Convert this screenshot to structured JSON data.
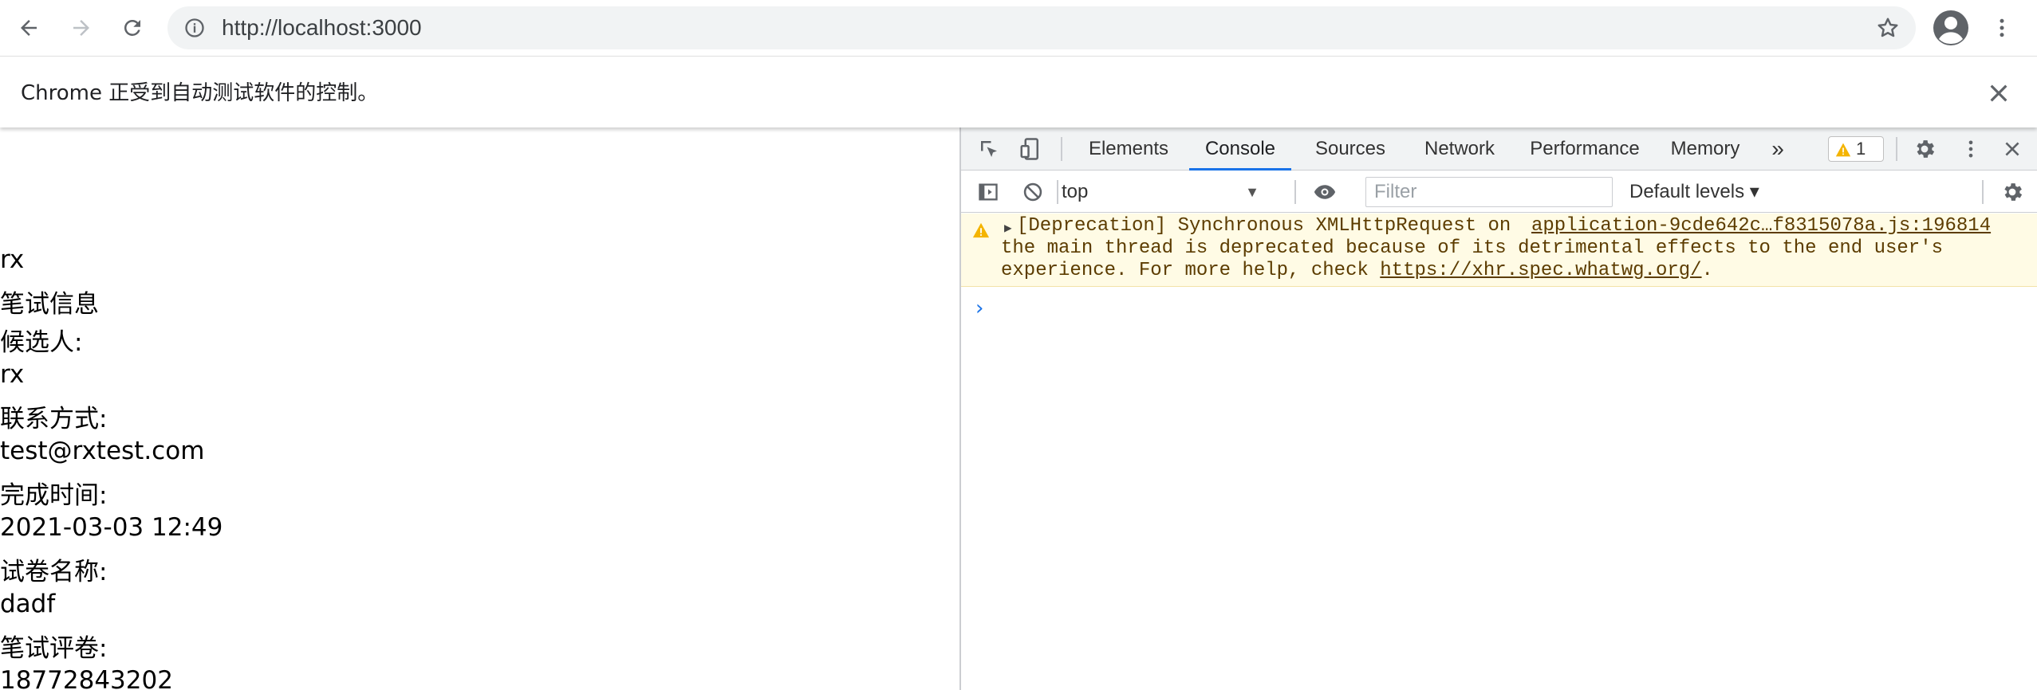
{
  "browser": {
    "url": "http://localhost:3000",
    "infobar_message": "Chrome 正受到自动测试软件的控制。"
  },
  "page": {
    "lines": [
      "rx",
      "笔试信息",
      "候选人:",
      "rx",
      "联系方式:",
      "test@rxtest.com",
      "完成时间:",
      "2021-03-03 12:49",
      "试卷名称:",
      "dadf",
      "笔试评卷:",
      "18772843202"
    ]
  },
  "devtools": {
    "tabs": [
      "Elements",
      "Console",
      "Sources",
      "Network",
      "Performance",
      "Memory"
    ],
    "active_tab": "Console",
    "more_tabs": "»",
    "warning_count": "1",
    "context": "top",
    "filter_placeholder": "Filter",
    "levels": "Default levels ▾",
    "warning": {
      "line1": "[Deprecation] Synchronous XMLHttpRequest on",
      "source": "application-9cde642c…f8315078a.js:196814",
      "line2": "the main thread is deprecated because of its detrimental effects to the end user's",
      "line3_prefix": "experience. For more help, check ",
      "line3_link": "https://xhr.spec.whatwg.org/",
      "line3_suffix": "."
    },
    "prompt": "›"
  },
  "colors": {
    "accent": "#1a73e8",
    "warning_bg": "#fffbe5",
    "warning_text": "#5c3c00",
    "warning_icon": "#f4b400"
  }
}
